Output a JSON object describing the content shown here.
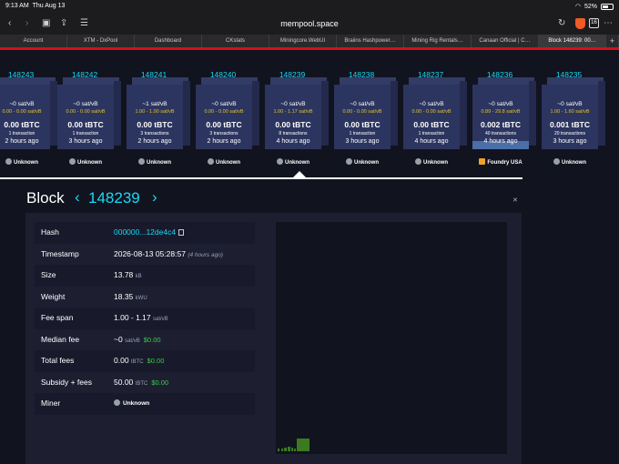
{
  "status": {
    "time": "9:13 AM",
    "date": "Thu Aug 13",
    "battery": "52%"
  },
  "browser": {
    "url": "mempool.space",
    "tab_count": "16"
  },
  "tabs": [
    {
      "label": "Account",
      "active": false
    },
    {
      "label": "XTM - DxPool",
      "active": false
    },
    {
      "label": "Dashboard",
      "active": false
    },
    {
      "label": "CKstats",
      "active": false
    },
    {
      "label": "Miningcore.WebUI",
      "active": false
    },
    {
      "label": "Braiins Hashpower…",
      "active": false
    },
    {
      "label": "Mining Rig Rentals…",
      "active": false
    },
    {
      "label": "Canaan Official | C…",
      "active": false
    },
    {
      "label": "Block 148239: 00…",
      "active": true
    }
  ],
  "blocks": [
    {
      "height": "148243",
      "fee": "~0 sat/vB",
      "span": "0.00 - 0.00 sat/vB",
      "total": "0.00 tBTC",
      "tx": "1 transaction",
      "ago": "2 hours ago",
      "miner": "Unknown",
      "fill": 0.0
    },
    {
      "height": "148242",
      "fee": "~0 sat/vB",
      "span": "0.00 - 0.00 sat/vB",
      "total": "0.00 tBTC",
      "tx": "1 transaction",
      "ago": "3 hours ago",
      "miner": "Unknown",
      "fill": 0.0
    },
    {
      "height": "148241",
      "fee": "~1 sat/vB",
      "span": "1.00 - 1.00 sat/vB",
      "total": "0.00 tBTC",
      "tx": "3 transactions",
      "ago": "2 hours ago",
      "miner": "Unknown",
      "fill": 0.0
    },
    {
      "height": "148240",
      "fee": "~0 sat/vB",
      "span": "0.00 - 0.00 sat/vB",
      "total": "0.00 tBTC",
      "tx": "3 transactions",
      "ago": "2 hours ago",
      "miner": "Unknown",
      "fill": 0.0
    },
    {
      "height": "148239",
      "fee": "~0 sat/vB",
      "span": "1.00 - 1.17 sat/vB",
      "total": "0.00 tBTC",
      "tx": "8 transactions",
      "ago": "4 hours ago",
      "miner": "Unknown",
      "fill": 0.0
    },
    {
      "height": "148238",
      "fee": "~0 sat/vB",
      "span": "0.00 - 0.00 sat/vB",
      "total": "0.00 tBTC",
      "tx": "1 transaction",
      "ago": "3 hours ago",
      "miner": "Unknown",
      "fill": 0.0
    },
    {
      "height": "148237",
      "fee": "~0 sat/vB",
      "span": "0.00 - 0.00 sat/vB",
      "total": "0.00 tBTC",
      "tx": "1 transaction",
      "ago": "4 hours ago",
      "miner": "Unknown",
      "fill": 0.0
    },
    {
      "height": "148236",
      "fee": "~0 sat/vB",
      "span": "0.89 - 29.8 sat/vB",
      "total": "0.002 tBTC",
      "tx": "40 transactions",
      "ago": "4 hours ago",
      "miner": "Foundry USA",
      "fill": 0.12
    },
    {
      "height": "148235",
      "fee": "~0 sat/vB",
      "span": "1.00 - 1.60 sat/vB",
      "total": "0.001 tBTC",
      "tx": "20 transactions",
      "ago": "3 hours ago",
      "miner": "Unknown",
      "fill": 0.0
    }
  ],
  "detail": {
    "title": "Block",
    "height": "148239",
    "rows": {
      "hash": {
        "label": "Hash",
        "value": "000000...12de4c4"
      },
      "timestamp": {
        "label": "Timestamp",
        "value": "2026-08-13 05:28:57",
        "ago": "(4 hours ago)"
      },
      "size": {
        "label": "Size",
        "value": "13.78",
        "unit": "kB"
      },
      "weight": {
        "label": "Weight",
        "value": "18.35",
        "unit": "kWU"
      },
      "fee_span": {
        "label": "Fee span",
        "value": "1.00 - 1.17",
        "unit": "sat/vB"
      },
      "median_fee": {
        "label": "Median fee",
        "value": "~0",
        "unit": "sat/vB",
        "fiat": "$0.00"
      },
      "total_fees": {
        "label": "Total fees",
        "value": "0.00",
        "unit": "tBTC",
        "fiat": "$0.00"
      },
      "subsidy": {
        "label": "Subsidy + fees",
        "value": "50.00",
        "unit": "tBTC",
        "fiat": "$0.00"
      },
      "miner": {
        "label": "Miner",
        "value": "Unknown"
      }
    }
  },
  "colors": {
    "accent": "#1bd8f4",
    "fee_span": "#e2c22e",
    "fiat": "#3bcc49",
    "block_face": "#2c355f"
  }
}
